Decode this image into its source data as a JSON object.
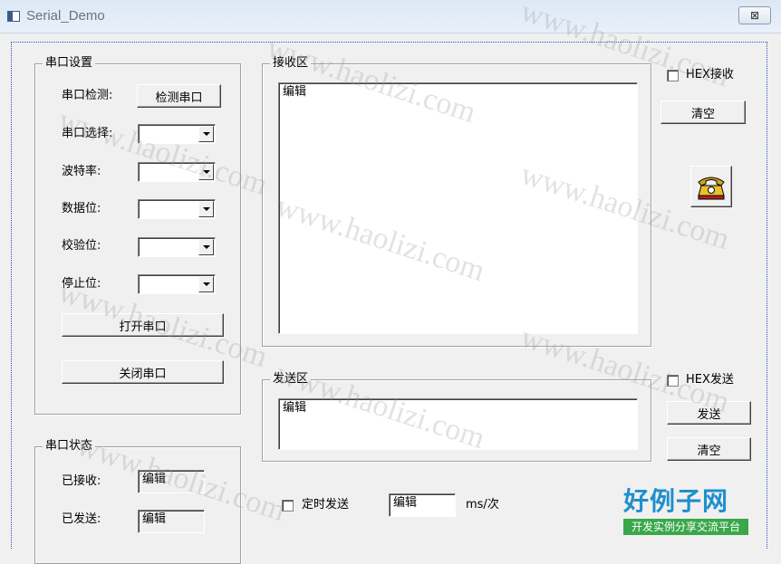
{
  "window": {
    "title": "Serial_Demo",
    "close_glyph": "⊠"
  },
  "serial_settings": {
    "legend": "串口设置",
    "detect_label": "串口检测:",
    "detect_button": "检测串口",
    "port_label": "串口选择:",
    "baud_label": "波特率:",
    "databits_label": "数据位:",
    "parity_label": "校验位:",
    "stopbits_label": "停止位:",
    "open_button": "打开串口",
    "close_button": "关闭串口"
  },
  "serial_status": {
    "legend": "串口状态",
    "received_label": "已接收:",
    "received_value": "编辑",
    "sent_label": "已发送:",
    "sent_value": "编辑"
  },
  "receive": {
    "legend": "接收区",
    "text": "编辑",
    "hex_label": "HEX接收",
    "clear_button": "清空"
  },
  "send": {
    "legend": "发送区",
    "text": "编辑",
    "hex_label": "HEX发送",
    "send_button": "发送",
    "clear_button": "清空",
    "timer_label": "定时发送",
    "interval_value": "编辑",
    "interval_unit": "ms/次"
  },
  "icons": {
    "phone": "telephone-icon"
  },
  "watermark": {
    "text": "www.haolizi.com"
  },
  "brand": {
    "name": "好例子网",
    "tagline": "开发实例分享交流平台",
    "color": "#1f8fcf",
    "tag_color": "#3aa84a"
  }
}
